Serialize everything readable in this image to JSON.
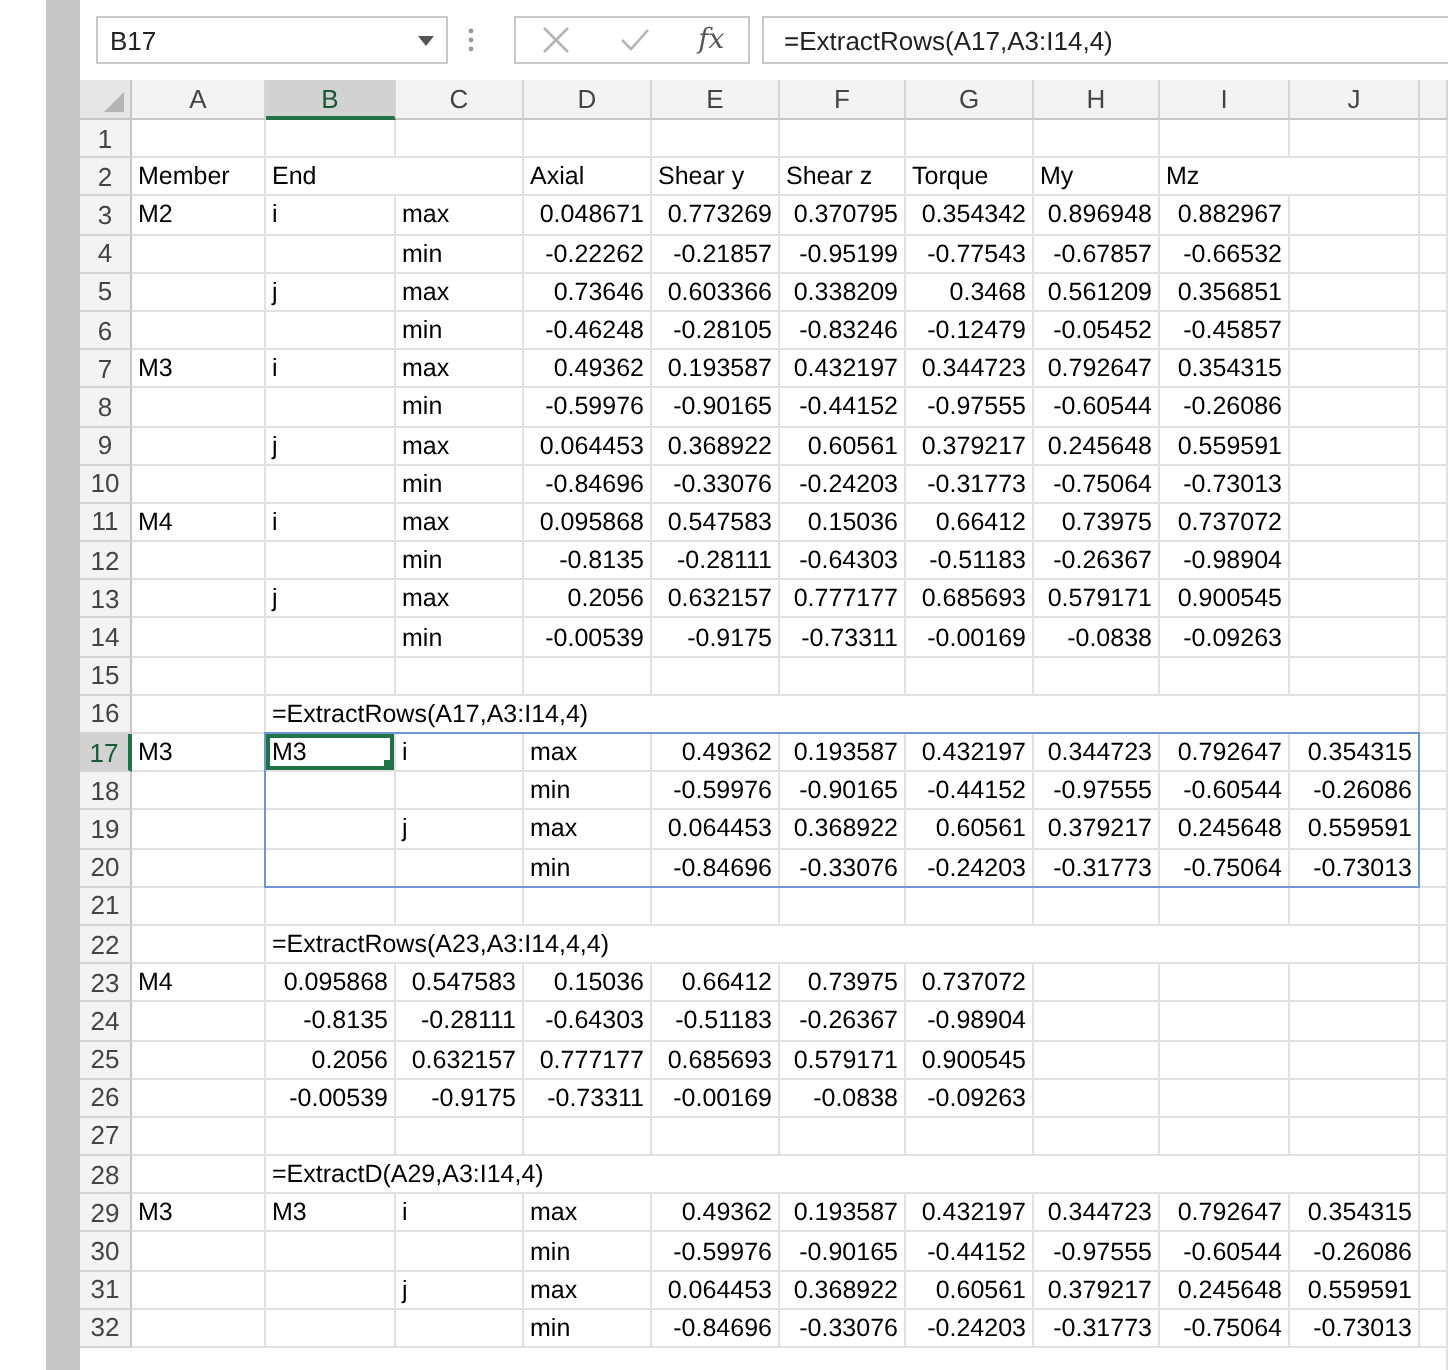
{
  "spill_outline": true,
  "formula_bar": {
    "name_box": "B17",
    "insert_function": "fx",
    "formula": "=ExtractRows(A17,A3:I14,4)",
    "cancel_enabled": false,
    "enter_enabled": false
  },
  "columns": [
    {
      "label": "A",
      "selected": false
    },
    {
      "label": "B",
      "selected": true
    },
    {
      "label": "C",
      "selected": false
    },
    {
      "label": "D",
      "selected": false
    },
    {
      "label": "E",
      "selected": false
    },
    {
      "label": "F",
      "selected": false
    },
    {
      "label": "G",
      "selected": false
    },
    {
      "label": "H",
      "selected": false
    },
    {
      "label": "I",
      "selected": false
    },
    {
      "label": "J",
      "selected": false
    }
  ],
  "rows": [
    {
      "label": "1",
      "selected": false
    },
    {
      "label": "2",
      "selected": false,
      "cells": [
        "Member",
        "End",
        null,
        "Axial",
        "Shear y",
        "Shear z",
        "Torque",
        "My",
        "Mz"
      ]
    },
    {
      "label": "3",
      "selected": false,
      "cells": [
        "M2",
        "i",
        "max",
        "0.048671",
        "0.773269",
        "0.370795",
        "0.354342",
        "0.896948",
        "0.882967"
      ]
    },
    {
      "label": "4",
      "selected": false,
      "cells": [
        null,
        null,
        "min",
        "-0.22262",
        "-0.21857",
        "-0.95199",
        "-0.77543",
        "-0.67857",
        "-0.66532"
      ]
    },
    {
      "label": "5",
      "selected": false,
      "cells": [
        null,
        "j",
        "max",
        "0.73646",
        "0.603366",
        "0.338209",
        "0.3468",
        "0.561209",
        "0.356851"
      ]
    },
    {
      "label": "6",
      "selected": false,
      "cells": [
        null,
        null,
        "min",
        "-0.46248",
        "-0.28105",
        "-0.83246",
        "-0.12479",
        "-0.05452",
        "-0.45857"
      ]
    },
    {
      "label": "7",
      "selected": false,
      "cells": [
        "M3",
        "i",
        "max",
        "0.49362",
        "0.193587",
        "0.432197",
        "0.344723",
        "0.792647",
        "0.354315"
      ]
    },
    {
      "label": "8",
      "selected": false,
      "cells": [
        null,
        null,
        "min",
        "-0.59976",
        "-0.90165",
        "-0.44152",
        "-0.97555",
        "-0.60544",
        "-0.26086"
      ]
    },
    {
      "label": "9",
      "selected": false,
      "cells": [
        null,
        "j",
        "max",
        "0.064453",
        "0.368922",
        "0.60561",
        "0.379217",
        "0.245648",
        "0.559591"
      ]
    },
    {
      "label": "10",
      "selected": false,
      "cells": [
        null,
        null,
        "min",
        "-0.84696",
        "-0.33076",
        "-0.24203",
        "-0.31773",
        "-0.75064",
        "-0.73013"
      ]
    },
    {
      "label": "11",
      "selected": false,
      "cells": [
        "M4",
        "i",
        "max",
        "0.095868",
        "0.547583",
        "0.15036",
        "0.66412",
        "0.73975",
        "0.737072"
      ]
    },
    {
      "label": "12",
      "selected": false,
      "cells": [
        null,
        null,
        "min",
        "-0.8135",
        "-0.28111",
        "-0.64303",
        "-0.51183",
        "-0.26367",
        "-0.98904"
      ]
    },
    {
      "label": "13",
      "selected": false,
      "cells": [
        null,
        "j",
        "max",
        "0.2056",
        "0.632157",
        "0.777177",
        "0.685693",
        "0.579171",
        "0.900545"
      ]
    },
    {
      "label": "14",
      "selected": false,
      "cells": [
        null,
        null,
        "min",
        "-0.00539",
        "-0.9175",
        "-0.73311",
        "-0.00169",
        "-0.0838",
        "-0.09263"
      ]
    },
    {
      "label": "15",
      "selected": false
    },
    {
      "label": "16",
      "selected": false,
      "cells": [
        null,
        "=ExtractRows(A17,A3:I14,4)"
      ]
    },
    {
      "label": "17",
      "selected": true,
      "cells": [
        "M3",
        "M3",
        "i",
        "max",
        "0.49362",
        "0.193587",
        "0.432197",
        "0.344723",
        "0.792647",
        "0.354315"
      ]
    },
    {
      "label": "18",
      "selected": false,
      "cells": [
        null,
        null,
        null,
        "min",
        "-0.59976",
        "-0.90165",
        "-0.44152",
        "-0.97555",
        "-0.60544",
        "-0.26086"
      ]
    },
    {
      "label": "19",
      "selected": false,
      "cells": [
        null,
        null,
        "j",
        "max",
        "0.064453",
        "0.368922",
        "0.60561",
        "0.379217",
        "0.245648",
        "0.559591"
      ]
    },
    {
      "label": "20",
      "selected": false,
      "cells": [
        null,
        null,
        null,
        "min",
        "-0.84696",
        "-0.33076",
        "-0.24203",
        "-0.31773",
        "-0.75064",
        "-0.73013"
      ]
    },
    {
      "label": "21",
      "selected": false
    },
    {
      "label": "22",
      "selected": false,
      "cells": [
        null,
        "=ExtractRows(A23,A3:I14,4,4)"
      ]
    },
    {
      "label": "23",
      "selected": false,
      "cells": [
        "M4",
        "0.095868",
        "0.547583",
        "0.15036",
        "0.66412",
        "0.73975",
        "0.737072"
      ]
    },
    {
      "label": "24",
      "selected": false,
      "cells": [
        null,
        "-0.8135",
        "-0.28111",
        "-0.64303",
        "-0.51183",
        "-0.26367",
        "-0.98904"
      ]
    },
    {
      "label": "25",
      "selected": false,
      "cells": [
        null,
        "0.2056",
        "0.632157",
        "0.777177",
        "0.685693",
        "0.579171",
        "0.900545"
      ]
    },
    {
      "label": "26",
      "selected": false,
      "cells": [
        null,
        "-0.00539",
        "-0.9175",
        "-0.73311",
        "-0.00169",
        "-0.0838",
        "-0.09263"
      ]
    },
    {
      "label": "27",
      "selected": false
    },
    {
      "label": "28",
      "selected": false,
      "cells": [
        null,
        "=ExtractD(A29,A3:I14,4)"
      ]
    },
    {
      "label": "29",
      "selected": false,
      "cells": [
        "M3",
        "M3",
        "i",
        "max",
        "0.49362",
        "0.193587",
        "0.432197",
        "0.344723",
        "0.792647",
        "0.354315"
      ]
    },
    {
      "label": "30",
      "selected": false,
      "cells": [
        null,
        null,
        null,
        "min",
        "-0.59976",
        "-0.90165",
        "-0.44152",
        "-0.97555",
        "-0.60544",
        "-0.26086"
      ]
    },
    {
      "label": "31",
      "selected": false,
      "cells": [
        null,
        null,
        "j",
        "max",
        "0.064453",
        "0.368922",
        "0.60561",
        "0.379217",
        "0.245648",
        "0.559591"
      ]
    },
    {
      "label": "32",
      "selected": false,
      "cells": [
        null,
        null,
        null,
        "min",
        "-0.84696",
        "-0.33076",
        "-0.24203",
        "-0.31773",
        "-0.75064",
        "-0.73013"
      ]
    }
  ]
}
